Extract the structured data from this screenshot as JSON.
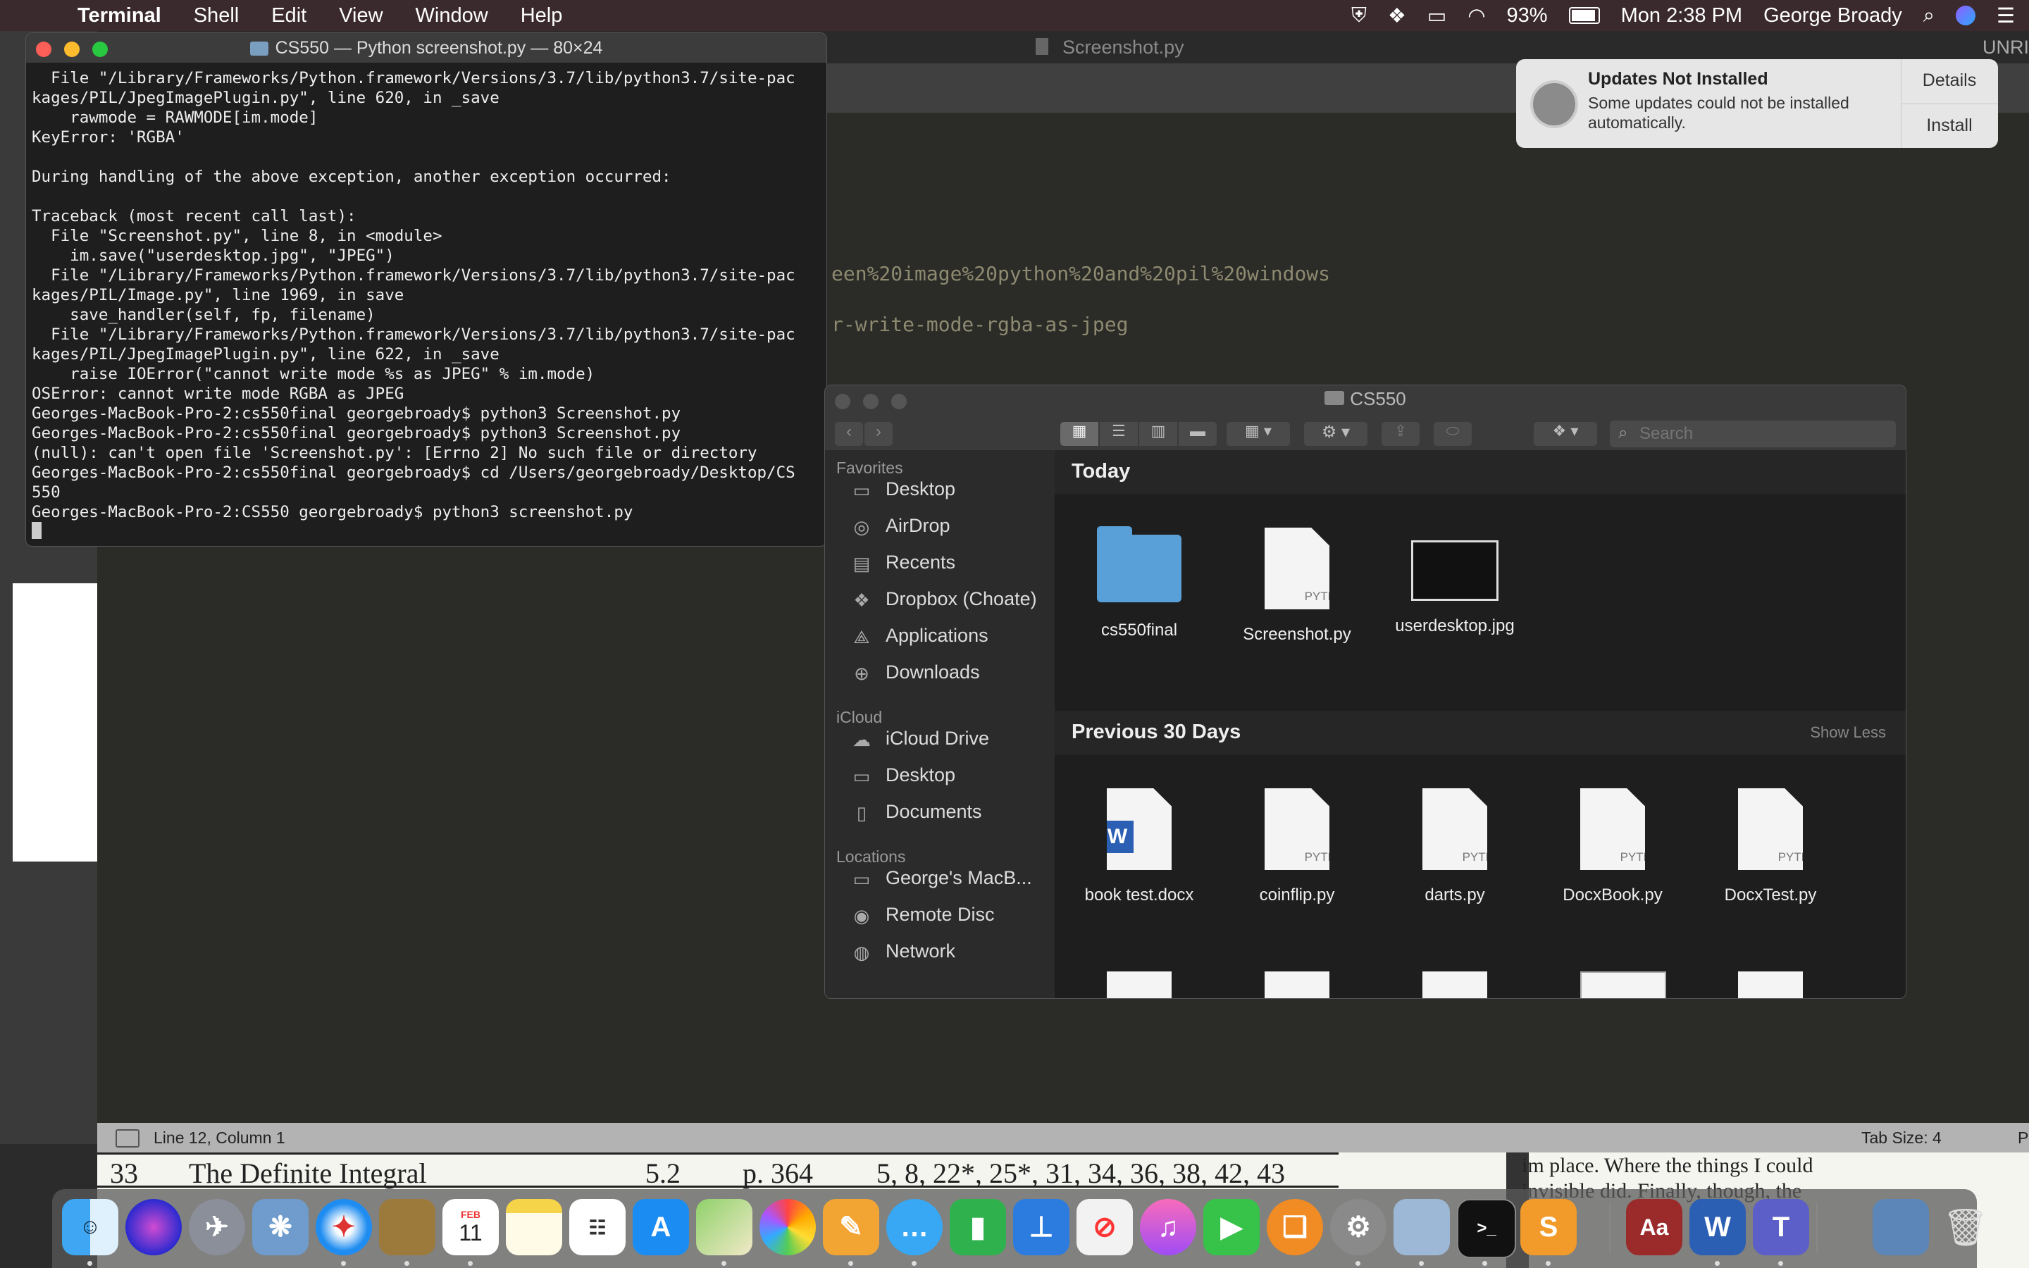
{
  "menubar": {
    "app": "Terminal",
    "items": [
      "Shell",
      "Edit",
      "View",
      "Window",
      "Help"
    ],
    "battery": "93%",
    "clock": "Mon 2:38 PM",
    "user": "George Broady"
  },
  "editor": {
    "title": "Screenshot.py",
    "right_edge_text": "UNRI",
    "code_line1": "een%20image%20python%20and%20pil%20windows",
    "code_line2": "r-write-mode-rgba-as-jpeg",
    "status_left": "Line 12, Column 1",
    "status_right": "Tab Size: 4",
    "status_far_right": "P"
  },
  "pdf": {
    "row_num": "33",
    "topic": "The Definite Integral",
    "section": "5.2",
    "page": "p. 364",
    "problems": "5, 8, 22*, 25*, 31, 34, 36, 38, 42, 43",
    "side_text1": "im place. Where the things I could",
    "side_text2": "invisible did. Finally, though, the"
  },
  "terminal": {
    "title": "CS550 — Python screenshot.py — 80×24",
    "lines": [
      "  File \"/Library/Frameworks/Python.framework/Versions/3.7/lib/python3.7/site-pac",
      "kages/PIL/JpegImagePlugin.py\", line 620, in _save",
      "    rawmode = RAWMODE[im.mode]",
      "KeyError: 'RGBA'",
      "",
      "During handling of the above exception, another exception occurred:",
      "",
      "Traceback (most recent call last):",
      "  File \"Screenshot.py\", line 8, in <module>",
      "    im.save(\"userdesktop.jpg\", \"JPEG\")",
      "  File \"/Library/Frameworks/Python.framework/Versions/3.7/lib/python3.7/site-pac",
      "kages/PIL/Image.py\", line 1969, in save",
      "    save_handler(self, fp, filename)",
      "  File \"/Library/Frameworks/Python.framework/Versions/3.7/lib/python3.7/site-pac",
      "kages/PIL/JpegImagePlugin.py\", line 622, in _save",
      "    raise IOError(\"cannot write mode %s as JPEG\" % im.mode)",
      "OSError: cannot write mode RGBA as JPEG",
      "Georges-MacBook-Pro-2:cs550final georgebroady$ python3 Screenshot.py",
      "Georges-MacBook-Pro-2:cs550final georgebroady$ python3 Screenshot.py",
      "(null): can't open file 'Screenshot.py': [Errno 2] No such file or directory",
      "Georges-MacBook-Pro-2:cs550final georgebroady$ cd /Users/georgebroady/Desktop/CS",
      "550",
      "Georges-MacBook-Pro-2:CS550 georgebroady$ python3 screenshot.py"
    ]
  },
  "notification": {
    "title": "Updates Not Installed",
    "body": "Some updates could not be installed automatically.",
    "details_button": "Details",
    "install_button": "Install"
  },
  "finder": {
    "title": "CS550",
    "search_placeholder": "Search",
    "favorites_heading": "Favorites",
    "favorites": [
      {
        "label": "Desktop",
        "icon": "desktop-icon"
      },
      {
        "label": "AirDrop",
        "icon": "airdrop-icon"
      },
      {
        "label": "Recents",
        "icon": "recents-icon"
      },
      {
        "label": "Dropbox (Choate)",
        "icon": "dropbox-icon"
      },
      {
        "label": "Applications",
        "icon": "applications-icon"
      },
      {
        "label": "Downloads",
        "icon": "downloads-icon"
      }
    ],
    "icloud_heading": "iCloud",
    "icloud": [
      {
        "label": "iCloud Drive",
        "icon": "cloud-icon"
      },
      {
        "label": "Desktop",
        "icon": "desktop-icon"
      },
      {
        "label": "Documents",
        "icon": "documents-icon"
      }
    ],
    "locations_heading": "Locations",
    "locations": [
      {
        "label": "George's MacB...",
        "icon": "laptop-icon"
      },
      {
        "label": "Remote Disc",
        "icon": "disc-icon"
      },
      {
        "label": "Network",
        "icon": "network-icon"
      }
    ],
    "today_heading": "Today",
    "today_files": [
      {
        "name": "cs550final",
        "kind": "folder"
      },
      {
        "name": "Screenshot.py",
        "kind": "python"
      },
      {
        "name": "userdesktop.jpg",
        "kind": "image"
      }
    ],
    "prev_heading": "Previous 30 Days",
    "show_less": "Show Less",
    "prev_files": [
      {
        "name": "book test.docx",
        "kind": "word"
      },
      {
        "name": "coinflip.py",
        "kind": "python"
      },
      {
        "name": "darts.py",
        "kind": "python"
      },
      {
        "name": "DocxBook.py",
        "kind": "python"
      },
      {
        "name": "DocxTest.py",
        "kind": "python"
      }
    ],
    "python_label": "PYTHON"
  },
  "dock": {
    "apps": [
      "finder",
      "siri",
      "launchpad",
      "preview",
      "safari",
      "notefile",
      "calendar",
      "notes",
      "reminders",
      "app-store",
      "maps",
      "photos",
      "pages",
      "messages",
      "numbers",
      "keynote",
      "news",
      "itunes",
      "facetime",
      "books",
      "system-preferences",
      "image-capture",
      "terminal",
      "sublime-text",
      "dictionary",
      "word",
      "teams",
      "preview-2",
      "trash"
    ],
    "calendar_month": "FEB",
    "calendar_day": "11"
  }
}
